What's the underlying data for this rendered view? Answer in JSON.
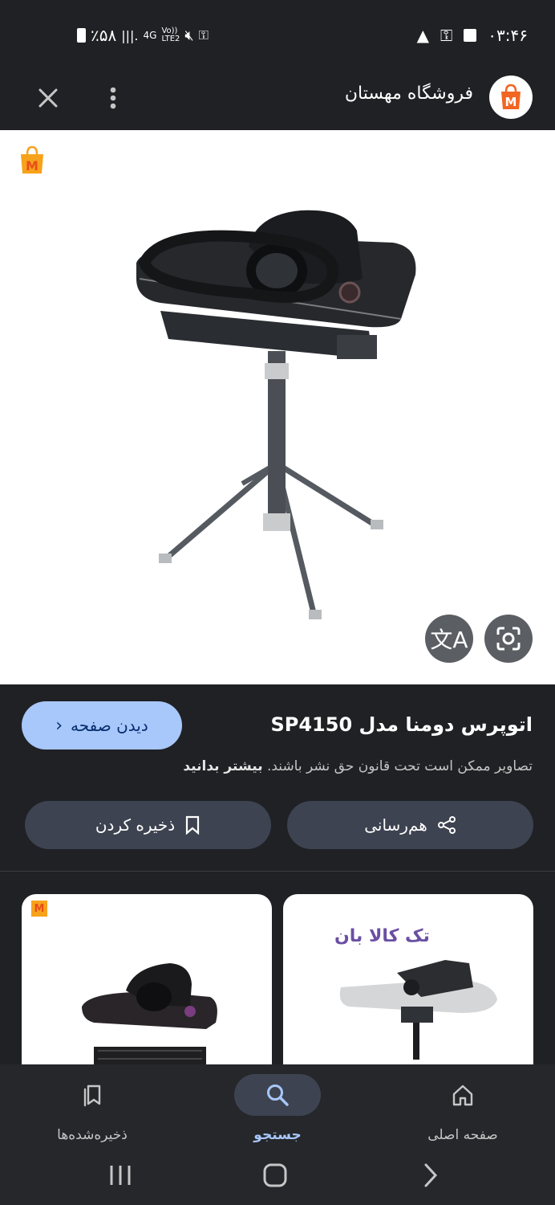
{
  "status_bar": {
    "time": "۰۳:۴۶",
    "battery": "٪۵۸",
    "network": "4G",
    "volte": "Vo))\nLTE2"
  },
  "header": {
    "site_name": "فروشگاه مهستان"
  },
  "logo_letter": "M",
  "product": {
    "title": "اتوپرس دومنا مدل SP4150",
    "visit_label": "دیدن صفحه",
    "copyright_text": "تصاویر ممکن است تحت قانون حق نشر باشند.",
    "learn_more": "بیشتر بدانید",
    "share_label": "هم‌رسانی",
    "save_label": "ذخیره کردن"
  },
  "related": {
    "brand_text": "تک کالا بان",
    "card_left_brand": "M"
  },
  "bottom_nav": {
    "items": [
      {
        "label": "صفحه اصلی"
      },
      {
        "label": "جستجو"
      },
      {
        "label": "ذخیره‌شده‌ها"
      }
    ]
  },
  "colors": {
    "background": "#1f2125",
    "accent": "#a8c7fa",
    "button_bg": "#3d4350",
    "logo_orange": "#f26522"
  }
}
